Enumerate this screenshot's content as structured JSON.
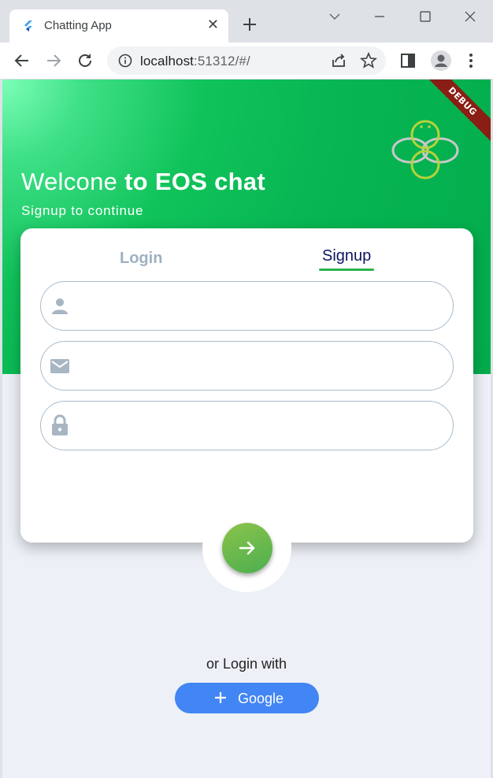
{
  "browser": {
    "tab_title": "Chatting App",
    "address_host": "localhost",
    "address_rest": ":51312/#/",
    "colors": {
      "chrome": "#dee1e6",
      "toolbar": "#ffffff",
      "omnibox": "#f1f3f4"
    }
  },
  "app": {
    "debug_banner": "DEBUG",
    "welcome_light": "Welcone ",
    "welcome_bold": "to EOS chat",
    "subtitle": "Signup to continue",
    "tabs": {
      "login": "Login",
      "signup": "Signup",
      "active": "Signup"
    },
    "fields": [
      {
        "name": "username",
        "icon": "person-icon",
        "value": "",
        "placeholder": ""
      },
      {
        "name": "email",
        "icon": "mail-icon",
        "value": "",
        "placeholder": ""
      },
      {
        "name": "password",
        "icon": "lock-icon",
        "value": "",
        "placeholder": ""
      }
    ],
    "submit_icon": "arrow-right-icon",
    "or_login_with": "or Login with",
    "google_label": "Google",
    "colors": {
      "hero_green": "#07b552",
      "background": "#edf1f7",
      "active_tab_text": "#0d1560",
      "inactive_tab_text": "#9eb0c2",
      "active_tab_underline": "#2bb34a",
      "field_border": "#a9bccc",
      "submit_green": "#6ab04c",
      "google_blue": "#4285f4",
      "debug_red": "#8a1d14"
    }
  }
}
